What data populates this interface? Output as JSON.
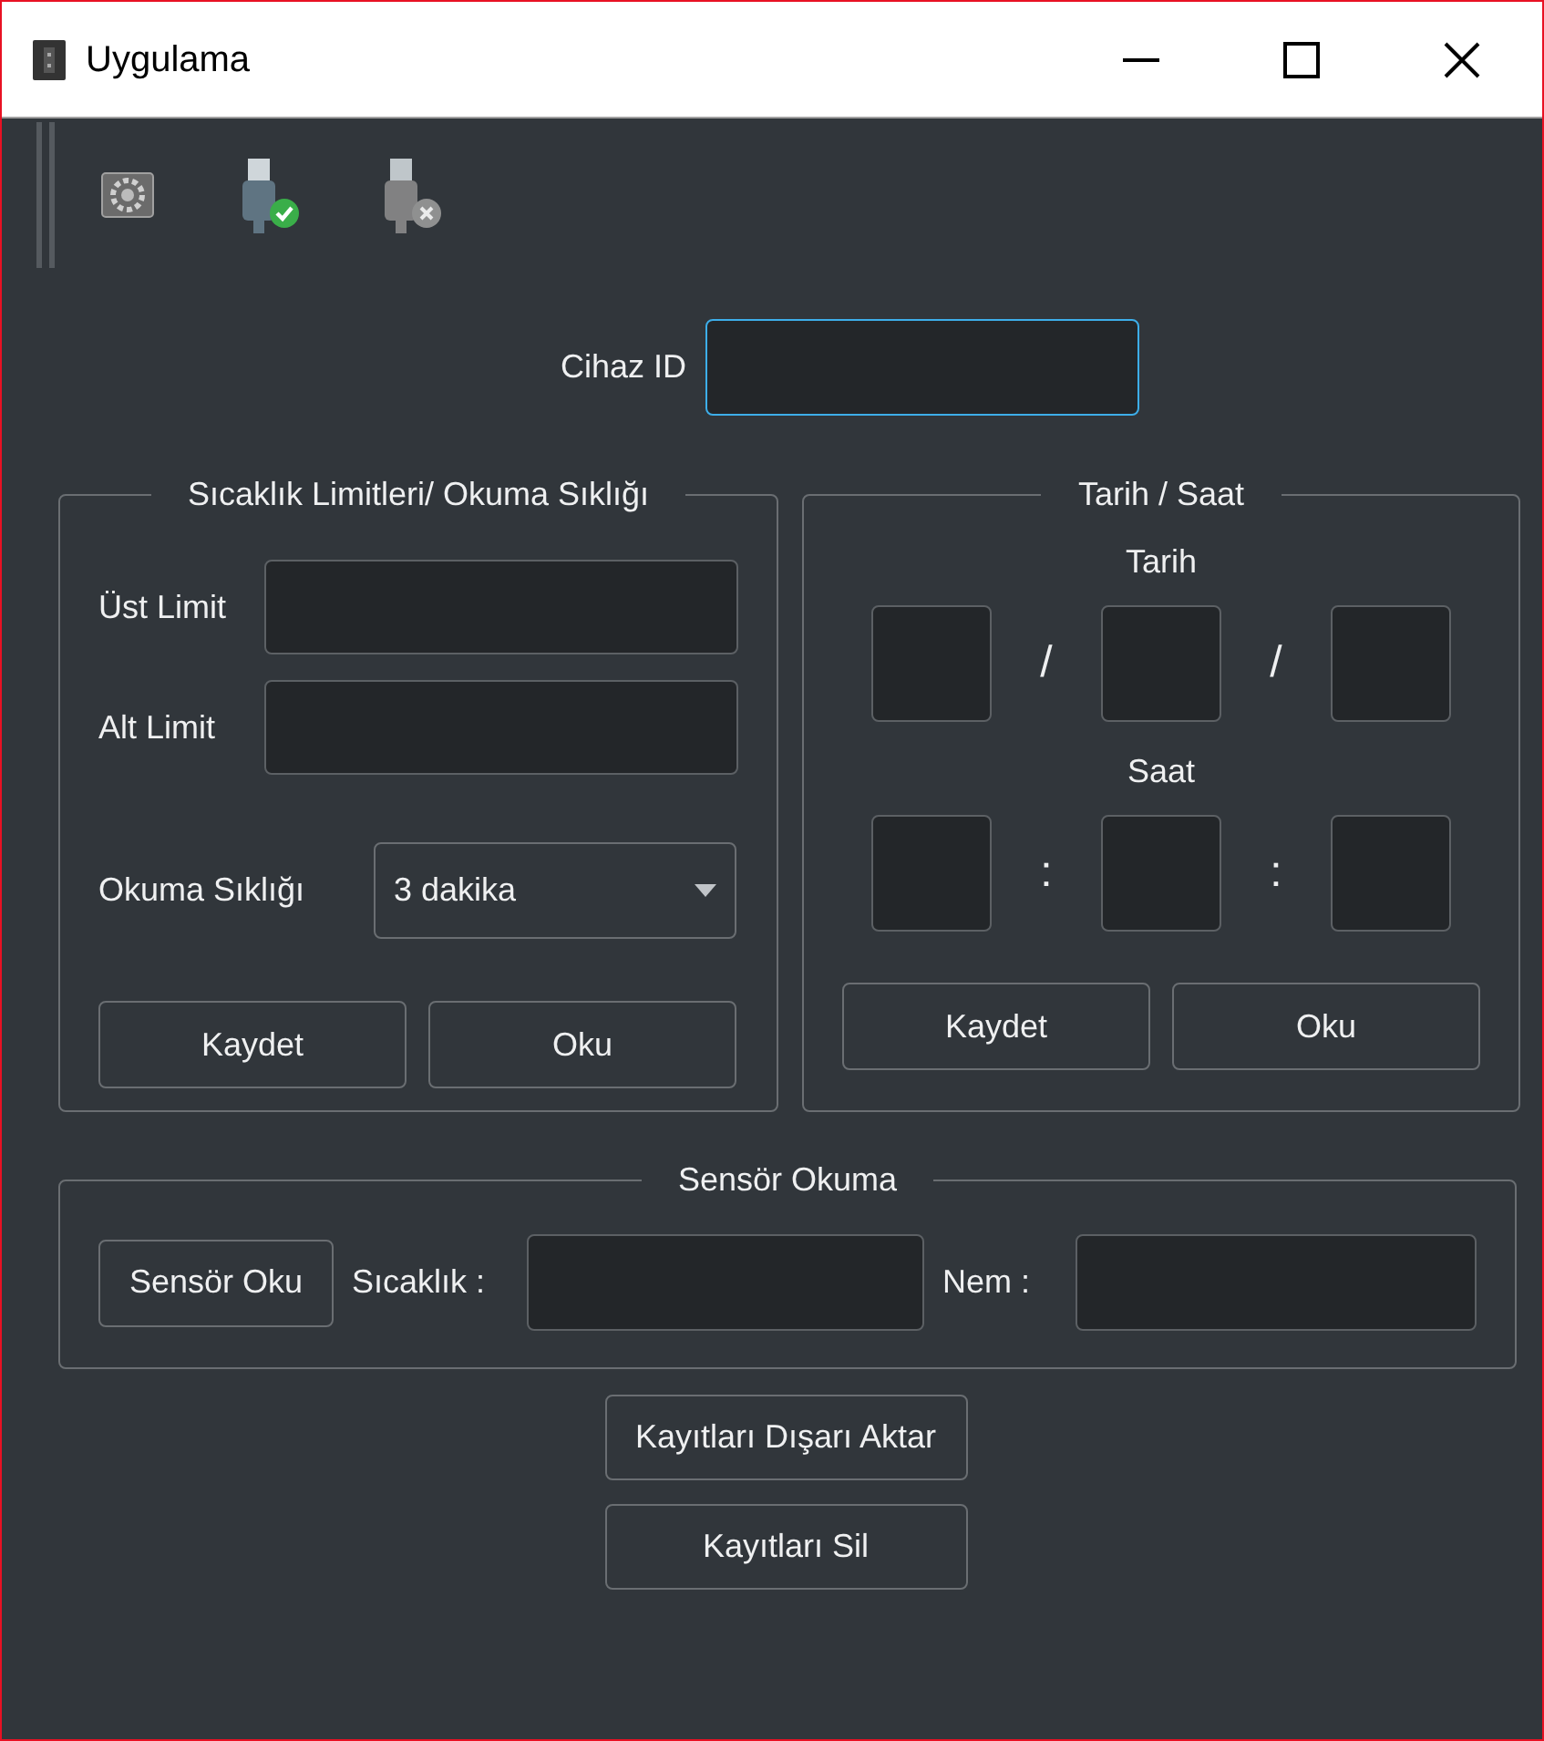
{
  "window": {
    "title": "Uygulama"
  },
  "toolbar": [
    {
      "kind": "settings"
    },
    {
      "kind": "connect",
      "disabled": false
    },
    {
      "kind": "disconnect",
      "disabled": true
    }
  ],
  "device_id": {
    "label": "Cihaz ID",
    "focused": true
  },
  "limits": {
    "title": "Sıcaklık Limitleri/ Okuma Sıklığı",
    "upper_label": "Üst Limit",
    "lower_label": "Alt Limit",
    "frequency_label": "Okuma Sıklığı",
    "frequency_value": "3 dakika",
    "buttons": [
      "Kaydet",
      "Oku"
    ]
  },
  "datetime": {
    "title": "Tarih / Saat",
    "date_label": "Tarih",
    "date_separators": [
      "/",
      "/"
    ],
    "time_label": "Saat",
    "time_separators": [
      ":",
      ":"
    ],
    "buttons": [
      "Kaydet",
      "Oku"
    ]
  },
  "sensor": {
    "title": "Sensör Okuma",
    "button": "Sensör Oku",
    "temperature_label": "Sıcaklık :",
    "humidity_label": "Nem :"
  },
  "actions": [
    "Kayıtları Dışarı Aktar",
    "Kayıtları Sil"
  ]
}
